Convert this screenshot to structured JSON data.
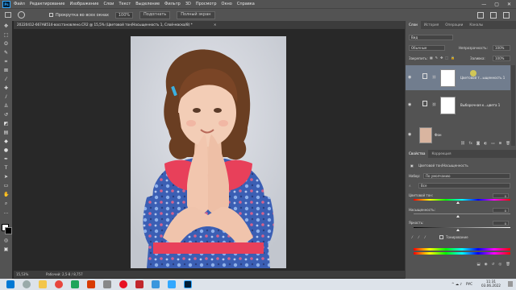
{
  "app": {
    "logo_text": "Ps"
  },
  "menu": [
    "Файл",
    "Редактирование",
    "Изображение",
    "Слои",
    "Текст",
    "Выделение",
    "Фильтр",
    "3D",
    "Просмотр",
    "Окно",
    "Справка"
  ],
  "window_controls": [
    "—",
    "▢",
    "✕"
  ],
  "options_bar": {
    "resize_all_label": "Прокрутка во всех окнах",
    "zoom_value": "100%",
    "fit_button": "Подогнать",
    "fullscreen_button": "Полный экран"
  },
  "document": {
    "tab_title": "20220412-667A8514-восстановлено.CR2 @ 15,5% (Цветовой тон/Насыщенность 1, Слой-маска/8) *",
    "close_glyph": "✕"
  },
  "status": {
    "zoom": "15,53%",
    "info": "Рабочий: 2,5-8 / 8,757"
  },
  "layers_panel": {
    "tabs": [
      "Слои",
      "История",
      "Операции",
      "Каналы"
    ],
    "kind_filter": "Вид",
    "blend_mode": "Обычные",
    "opacity_label": "Непрозрачность:",
    "opacity_value": "100%",
    "lock_label": "Закрепить:",
    "fill_label": "Заливка:",
    "fill_value": "100%",
    "layers": [
      {
        "name": "Цветовой т...ыщенность 1",
        "selected": true
      },
      {
        "name": "Выборочная к...цвета 1",
        "selected": false
      },
      {
        "name": "Фон",
        "selected": false
      }
    ]
  },
  "properties_panel": {
    "tabs": [
      "Свойства",
      "Коррекция"
    ],
    "adjustment_title": "Цветовой тон/Насыщенность",
    "preset_label": "Набор:",
    "preset_value": "По умолчанию",
    "range_value": "Все",
    "hue_label": "Цветовой тон:",
    "hue_value": "0",
    "saturation_label": "Насыщенность:",
    "saturation_value": "0",
    "lightness_label": "Яркость:",
    "lightness_value": "0",
    "colorize_label": "Тонирование"
  },
  "taskbar": {
    "tray_lang": "РУС",
    "time": "11:31",
    "date": "03.06.2022"
  },
  "colors": {
    "chrome": "#535353",
    "canvas_bg": "#282828",
    "selected_layer": "#717d8e",
    "dress_blue": "#3b5fb4",
    "collar_pink": "#e8405a"
  }
}
